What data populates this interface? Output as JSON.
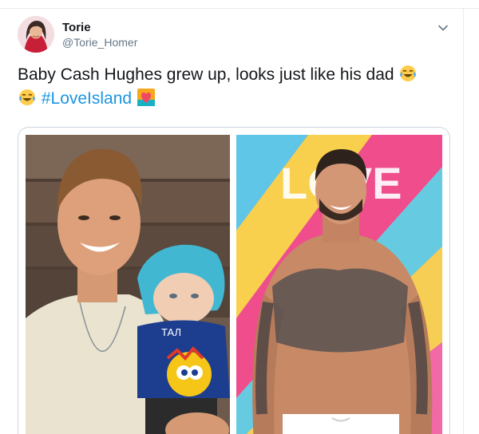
{
  "tweet": {
    "display_name": "Torie",
    "handle": "@Torie_Homer",
    "text": "Baby Cash Hughes grew up, looks just like his dad",
    "hashtag": "#LoveIsland"
  },
  "photos": [
    {
      "description_icon": "photo-man-with-baby-doll-icon",
      "caption_text": "ТАЛ"
    },
    {
      "description_icon": "photo-tattooed-man-icon",
      "backdrop_text": "LOVE"
    }
  ],
  "colors": {
    "accent": "#1b95e0",
    "text": "#14171a",
    "secondary": "#657786",
    "border": "#ccd6dd"
  }
}
